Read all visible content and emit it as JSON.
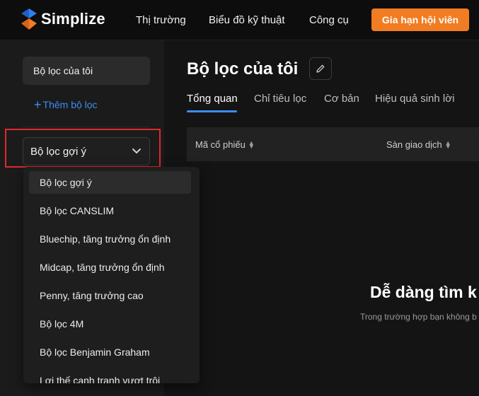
{
  "brand": {
    "name": "Simplize"
  },
  "nav": [
    {
      "label": "Thị trường"
    },
    {
      "label": "Biểu đồ kỹ thuật"
    },
    {
      "label": "Công cụ"
    }
  ],
  "cta": {
    "label": "Gia hạn hội viên",
    "color": "#f27c22"
  },
  "sidebar": {
    "my_filter": "Bộ lọc của tôi",
    "add_filter": "Thêm bộ lọc",
    "select_value": "Bộ lọc gợi ý",
    "dropdown_options": [
      "Bộ lọc gợi ý",
      "Bộ lọc CANSLIM",
      "Bluechip, tăng trưởng ổn định",
      "Midcap, tăng trưởng ổn định",
      "Penny, tăng trưởng cao",
      "Bộ lọc 4M",
      "Bộ lọc Benjamin Graham",
      "Lợi thế cạnh tranh vượt trội"
    ]
  },
  "main": {
    "title": "Bộ lọc của tôi",
    "tabs": [
      "Tổng quan",
      "Chỉ tiêu lọc",
      "Cơ bản",
      "Hiệu quả sinh lời"
    ],
    "active_tab": "Tổng quan",
    "columns": [
      "Mã cổ phiếu",
      "Sàn giao dịch"
    ],
    "empty_title": "Dễ dàng tìm k",
    "empty_subtitle": "Trong trường hợp bạn không b"
  },
  "colors": {
    "accent": "#3b8ff0",
    "highlight_border": "#e0282e",
    "background": "#141414"
  }
}
